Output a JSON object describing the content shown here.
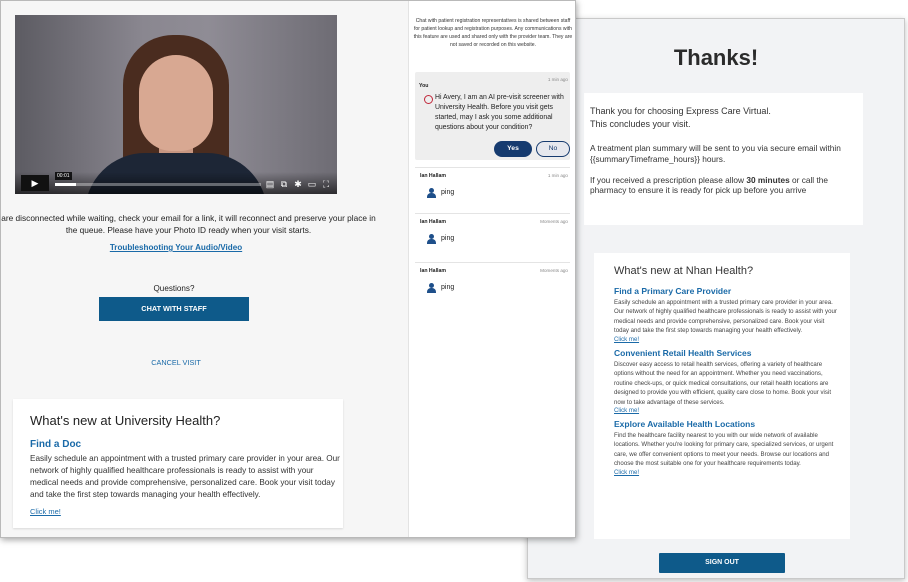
{
  "thanks_window": {
    "title": "Thanks!",
    "lead": "Thank you for choosing Express Care Virtual.\nThis concludes your visit.",
    "summary_text": "A treatment plan summary will be sent to you via secure email within {{summaryTimeframe_hours}} hours.",
    "prescription_prefix": "If you received a prescription please allow ",
    "prescription_bold": "30 minutes",
    "prescription_suffix": " or call the pharmacy to ensure it is ready for pick up before you arrive",
    "whats_new": {
      "heading": "What's new at Nhan Health?",
      "items": [
        {
          "title": "Find a Primary Care Provider",
          "body": "Easily schedule an appointment with a trusted primary care provider in your area. Our network of highly qualified healthcare professionals is ready to assist with your medical needs and provide comprehensive, personalized care. Book your visit today and take the first step towards managing your health effectively.",
          "link": "Click me!"
        },
        {
          "title": "Convenient Retail Health Services",
          "body": "Discover easy access to retail health services, offering a variety of healthcare options without the need for an appointment. Whether you need vaccinations, routine check-ups, or quick medical consultations, our retail health locations are designed to provide you with efficient, quality care close to home. Book your visit now to take advantage of these services.",
          "link": "Click me!"
        },
        {
          "title": "Explore Available Health Locations",
          "body": "Find the healthcare facility nearest to you with our wide network of available locations. Whether you're looking for primary care, specialized services, or urgent care, we offer convenient options to meet your needs. Browse our locations and choose the most suitable one for your healthcare requirements today.",
          "link": "Click me!"
        }
      ]
    },
    "sign_out_label": "SIGN OUT"
  },
  "visit_window": {
    "video": {
      "timestamp": "00:01",
      "progress_fraction": 0.1,
      "play_glyph": "▶",
      "icons": [
        "captions-icon",
        "picture-in-picture-icon",
        "settings-icon",
        "cast-icon",
        "fullscreen-icon"
      ]
    },
    "notice": "are disconnected while waiting, check your email for a link, it will reconnect and preserve your place in the queue. Please have your Photo ID ready when your visit starts.",
    "troubleshoot_link": "Troubleshooting Your Audio/Video",
    "questions_label": "Questions?",
    "chat_button": "CHAT WITH STAFF",
    "cancel_link": "CANCEL VISIT",
    "whats_new": {
      "heading": "What's new at University Health?",
      "item_title": "Find a Doc",
      "item_body": "Easily schedule an appointment with a trusted primary care provider in your area. Our network of highly qualified healthcare professionals is ready to assist with your medical needs and provide comprehensive, personalized care. Book your visit today and take the first step towards managing your health effectively.",
      "link": "Click me!"
    }
  },
  "chat_panel": {
    "intro": "Chat with patient registration representatives is shared between staff for patient lookup and registration purposes. Any communications with this feature are used and shared only with the provider team. They are not saved or recorded on this website.",
    "ai_message": {
      "timestamp": "1 min ago",
      "sender": "You",
      "text": "Hi Avery, I am an AI pre-visit screener with University Health. Before you visit gets started, may I ask you some additional questions about your condition?",
      "yes_label": "Yes",
      "no_label": "No"
    },
    "messages": [
      {
        "sender": "Ian Hallam",
        "timestamp": "1 min ago",
        "text": "ping"
      },
      {
        "sender": "Ian Hallam",
        "timestamp": "Moments ago",
        "text": "ping"
      },
      {
        "sender": "Ian Hallam",
        "timestamp": "Moments ago",
        "text": "ping"
      }
    ]
  }
}
